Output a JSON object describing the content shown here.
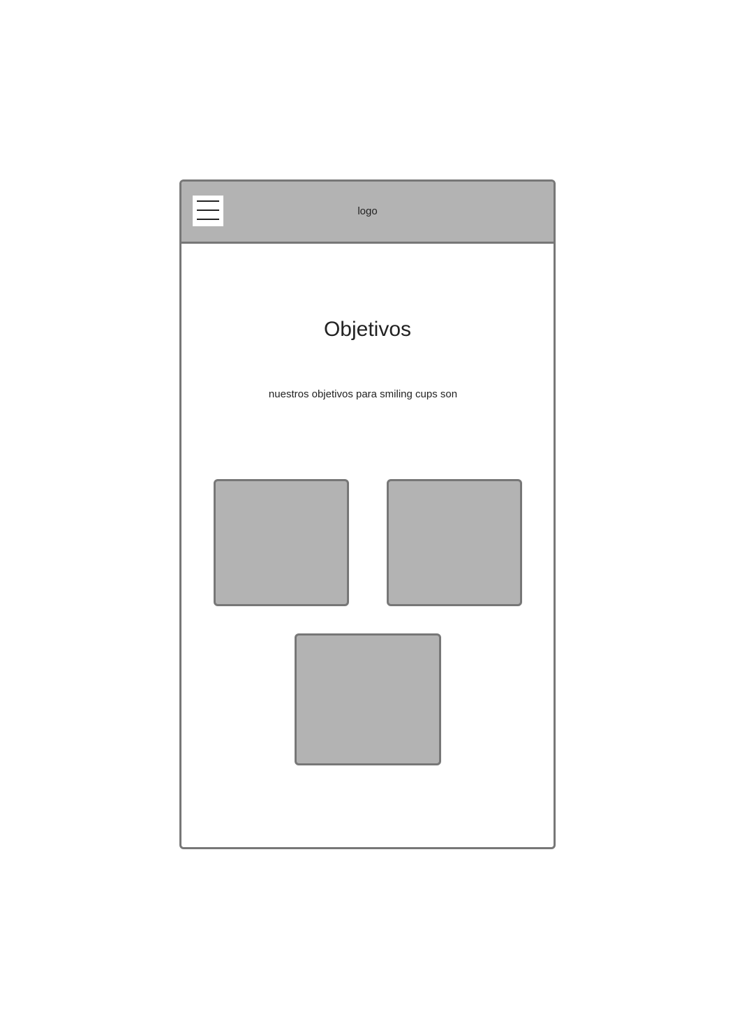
{
  "header": {
    "logo": "logo",
    "menu_icon": "hamburger-menu-icon"
  },
  "main": {
    "title": "Objetivos",
    "subtitle": "nuestros objetivos para smiling cups son",
    "cards": [
      "",
      "",
      ""
    ]
  },
  "colors": {
    "background": "#ffffff",
    "placeholder_fill": "#b3b3b3",
    "border": "#777777",
    "text": "#222222"
  }
}
